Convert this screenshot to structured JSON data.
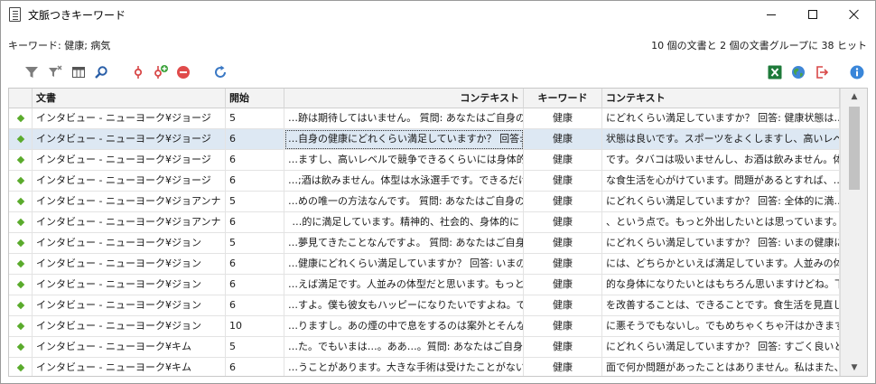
{
  "window": {
    "title": "文脈つきキーワード"
  },
  "info": {
    "keywords": "キーワード: 健康; 病気",
    "summary": "10 個の文書と 2 個の文書グループに 38 ヒット"
  },
  "toolbar": {
    "left_icons": [
      "filter-icon",
      "clear-filter-icon",
      "columns-icon",
      "search-icon",
      "add-keyword-icon",
      "add-code-icon",
      "remove-icon",
      "refresh-icon"
    ],
    "right_icons": [
      "excel-export-icon",
      "web-export-icon",
      "export-icon",
      "info-icon"
    ],
    "colors": {
      "accent": "#3a78c4",
      "red": "#d84848",
      "green": "#1e7a3a",
      "marker": "#5aab2c",
      "selection": "#dde8f3"
    }
  },
  "table": {
    "columns": [
      "",
      "文書",
      "開始",
      "コンテキスト",
      "キーワード",
      "コンテキスト"
    ],
    "rows": [
      {
        "doc": "インタビュー - ニューヨーク¥ジョージ",
        "start": "5",
        "ctx_before": "…跡は期待してはいません。 質問: あなたはご自身の",
        "keyword": "健康",
        "ctx_after": "にどれくらい満足していますか？ 回答: 健康状態は…",
        "selected": false
      },
      {
        "doc": "インタビュー - ニューヨーク¥ジョージ",
        "start": "6",
        "ctx_before": "…自身の健康にどれくらい満足していますか？ 回答:",
        "keyword": "健康",
        "ctx_after": "状態は良いです。スポーツをよくしますし、高いレベル…",
        "selected": true
      },
      {
        "doc": "インタビュー - ニューヨーク¥ジョージ",
        "start": "6",
        "ctx_before": "…ますし、高いレベルで競争できるくらいには身体的に",
        "keyword": "健康",
        "ctx_after": "です。タバコは吸いませんし、お酒は飲みません。体…",
        "selected": false
      },
      {
        "doc": "インタビュー - ニューヨーク¥ジョージ",
        "start": "6",
        "ctx_before": "…;酒は飲みません。体型は水泳選手です。できるだけ",
        "keyword": "健康",
        "ctx_after": "な食生活を心がけています。問題があるとすれば、…",
        "selected": false
      },
      {
        "doc": "インタビュー - ニューヨーク¥ジョアンナ",
        "start": "5",
        "ctx_before": "…めの唯一の方法なんです。 質問: あなたはご自身の",
        "keyword": "健康",
        "ctx_after": "にどれくらい満足していますか？ 回答: 全体的に満…",
        "selected": false
      },
      {
        "doc": "インタビュー - ニューヨーク¥ジョアンナ",
        "start": "6",
        "ctx_before": "…的に満足しています。精神的、社会的、身体的に",
        "keyword": "健康",
        "ctx_after": "、という点で。もっと外出したいとは思っています。私…",
        "selected": false
      },
      {
        "doc": "インタビュー - ニューヨーク¥ジョン",
        "start": "5",
        "ctx_before": "…夢見てきたことなんですよ。 質問: あなたはご自身の",
        "keyword": "健康",
        "ctx_after": "にどれくらい満足していますか？ 回答: いまの健康に…",
        "selected": false
      },
      {
        "doc": "インタビュー - ニューヨーク¥ジョン",
        "start": "6",
        "ctx_before": "…健康にどれくらい満足していますか？ 回答: いまの",
        "keyword": "健康",
        "ctx_after": "には、どちらかといえば満足しています。人並みの体型だ…",
        "selected": false
      },
      {
        "doc": "インタビュー - ニューヨーク¥ジョン",
        "start": "6",
        "ctx_before": "…えば満足です。人並みの体型だと思います。もっと",
        "keyword": "健康",
        "ctx_after": "的な身体になりたいとはもちろん思いますけどね。下…",
        "selected": false
      },
      {
        "doc": "インタビュー - ニューヨーク¥ジョン",
        "start": "6",
        "ctx_before": "…すよ。僕も彼女もハッピーになりたいですよね。でも、",
        "keyword": "健康",
        "ctx_after": "を改善することは、できることです。食生活を見直し…",
        "selected": false
      },
      {
        "doc": "インタビュー - ニューヨーク¥ジョン",
        "start": "10",
        "ctx_before": "…りますし。あの煙の中で息をするのは案外とそんなに",
        "keyword": "健康",
        "ctx_after": "に悪そうでもないし。でもめちゃくちゃ汗はかきますね…",
        "selected": false
      },
      {
        "doc": "インタビュー - ニューヨーク¥キム",
        "start": "5",
        "ctx_before": "…た。でもいまは…。ああ…。質問: あなたはご自身の",
        "keyword": "健康",
        "ctx_after": "にどれくらい満足していますか？ 回答: すごく良いと…",
        "selected": false
      },
      {
        "doc": "インタビュー - ニューヨーク¥キム",
        "start": "6",
        "ctx_before": "…うことがあります。大きな手術は受けたことがないし、",
        "keyword": "健康",
        "ctx_after": "面で何か問題があったことはありません。私はまた、…",
        "selected": false
      }
    ]
  }
}
